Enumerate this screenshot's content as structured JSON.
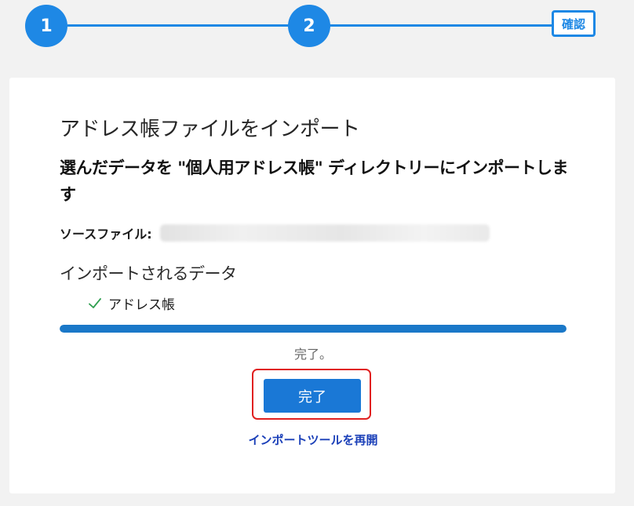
{
  "stepper": {
    "steps": [
      {
        "label": "1"
      },
      {
        "label": "2"
      },
      {
        "label": "確認"
      }
    ],
    "accent_color": "#1e88e5"
  },
  "card": {
    "title": "アドレス帳ファイルをインポート",
    "subtitle": "選んだデータを \"個人用アドレス帳\" ディレクトリーにインポートします",
    "source_label": "ソースファイル:",
    "source_value_redacted": true,
    "imported_heading": "インポートされるデータ",
    "imported_items": [
      {
        "label": "アドレス帳",
        "icon": "check-icon",
        "status_color": "#2e9e4f"
      }
    ],
    "progress_percent": 100,
    "progress_color": "#1a78c8",
    "status_text": "完了。",
    "done_button_label": "完了",
    "restart_link_label": "インポートツールを再開",
    "highlight_color": "#e02020"
  }
}
